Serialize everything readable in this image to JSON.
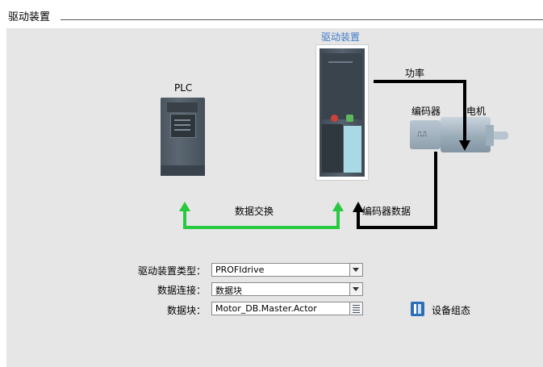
{
  "section": {
    "title": "驱动装置"
  },
  "diagram": {
    "drive_title": "驱动装置",
    "plc_label": "PLC",
    "power_label": "功率",
    "encoder_label": "编码器",
    "motor_label": "电机",
    "data_exchange_label": "数据交换",
    "encoder_data_label": "编码器数据",
    "encoder_symbol": "⎍⎍",
    "colors": {
      "data_exchange_arrow": "#27c93f",
      "power_arrow": "#000000",
      "drive_title": "#3f7bc6"
    }
  },
  "form": {
    "drive_type": {
      "label": "驱动装置类型：",
      "value": "PROFIdrive"
    },
    "data_connection": {
      "label": "数据连接：",
      "value": "数据块"
    },
    "data_block": {
      "label": "数据块：",
      "value": "Motor_DB.Master.Actor"
    }
  },
  "device_config": {
    "label": "设备组态"
  }
}
